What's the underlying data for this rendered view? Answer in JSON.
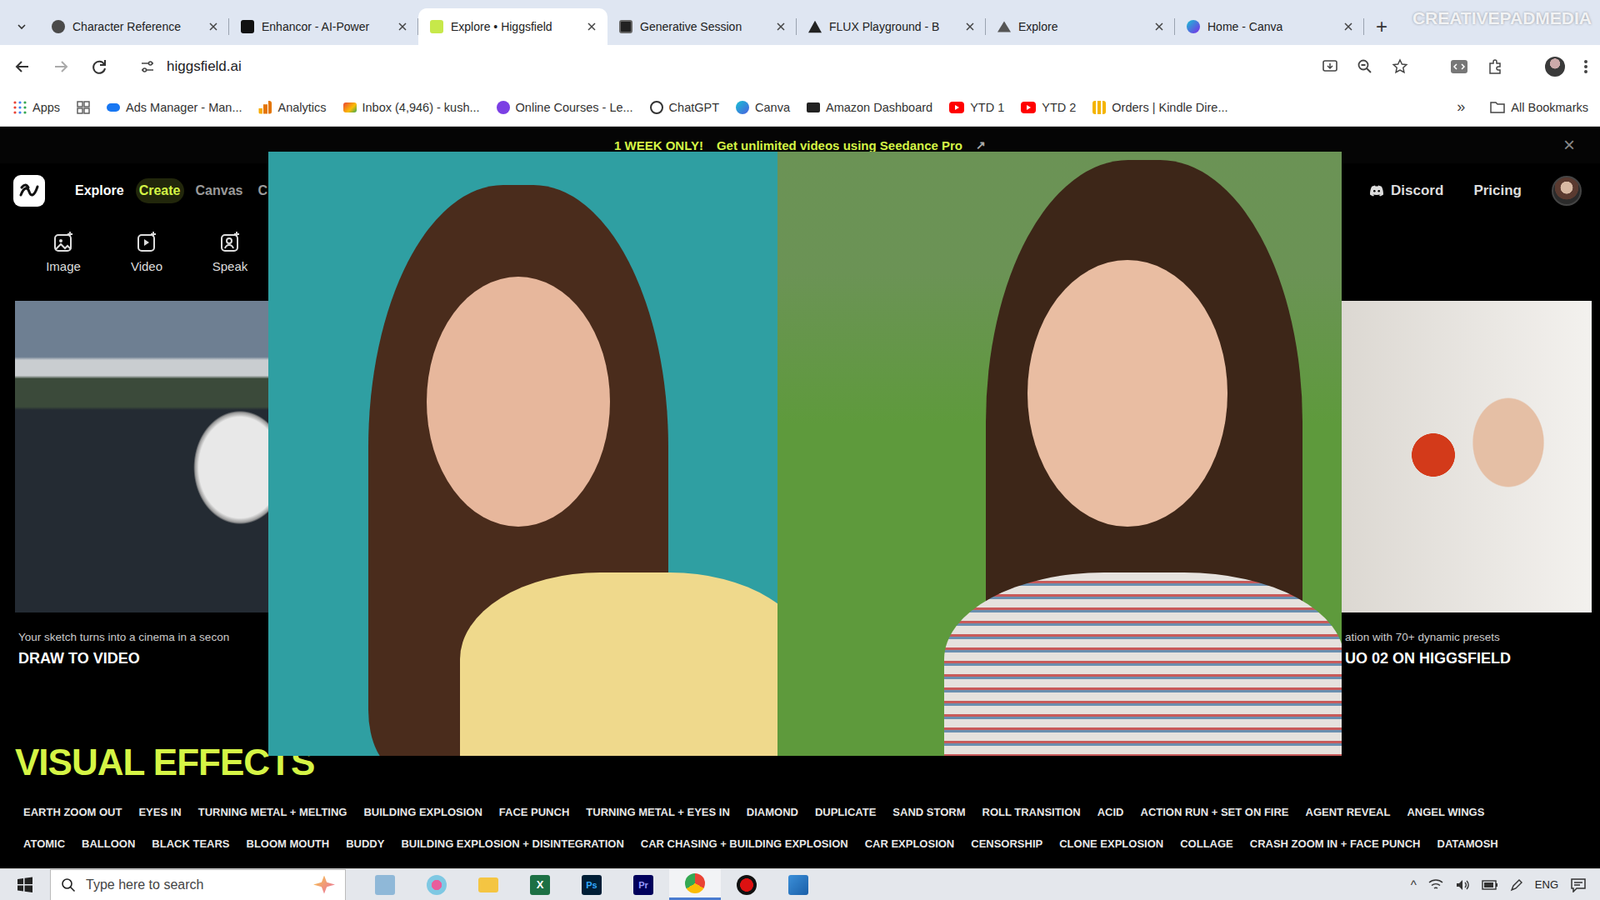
{
  "browser": {
    "tabs": [
      {
        "label": "Character Reference",
        "selected": false,
        "icon": "generic"
      },
      {
        "label": "Enhancor - AI-Power",
        "selected": false,
        "icon": "enhancor"
      },
      {
        "label": "Explore • Higgsfield",
        "selected": true,
        "icon": "higgsfield"
      },
      {
        "label": "Generative Session",
        "selected": false,
        "icon": "generative"
      },
      {
        "label": "FLUX Playground - B",
        "selected": false,
        "icon": "flux"
      },
      {
        "label": "Explore",
        "selected": false,
        "icon": "explore"
      },
      {
        "label": "Home - Canva",
        "selected": false,
        "icon": "canva"
      }
    ],
    "new_tab": "+",
    "watermark": "CREATIVEPADMEDIA",
    "url": "higgsfield.ai",
    "bookmarks": [
      {
        "label": "Apps",
        "icon": "apps"
      },
      {
        "label": "Ads Manager - Man...",
        "icon": "meta"
      },
      {
        "label": "Analytics",
        "icon": "analytics"
      },
      {
        "label": "Inbox (4,946) - kush...",
        "icon": "gmail"
      },
      {
        "label": "Online Courses - Le...",
        "icon": "courses"
      },
      {
        "label": "ChatGPT",
        "icon": "chatgpt"
      },
      {
        "label": "Canva",
        "icon": "canva"
      },
      {
        "label": "Amazon Dashboard",
        "icon": "amazon"
      },
      {
        "label": "YTD 1",
        "icon": "youtube"
      },
      {
        "label": "YTD 2",
        "icon": "youtube"
      },
      {
        "label": "Orders | Kindle Dire...",
        "icon": "kindle"
      }
    ],
    "bookmarks_more": "»",
    "all_bookmarks": "All Bookmarks"
  },
  "page": {
    "banner": {
      "highlight": "1 WEEK ONLY!",
      "text": "Get unlimited videos using Seedance Pro",
      "arrow": "↗",
      "close": "×"
    },
    "nav": {
      "items": [
        {
          "label": "Explore",
          "selected": true,
          "hovered": false
        },
        {
          "label": "Create",
          "selected": false,
          "hovered": true
        },
        {
          "label": "Canvas",
          "selected": false,
          "hovered": false
        },
        {
          "label": "C",
          "selected": false,
          "hovered": false
        }
      ],
      "right": [
        {
          "label": "Discord",
          "icon": "discord"
        },
        {
          "label": "Pricing",
          "icon": "none"
        }
      ]
    },
    "create_menu": [
      {
        "label": "Image",
        "icon": "image"
      },
      {
        "label": "Video",
        "icon": "video"
      },
      {
        "label": "Speak",
        "icon": "speak"
      }
    ],
    "cards": [
      {
        "caption": "Your sketch turns into a cinema in a secon",
        "title": "DRAW TO VIDEO"
      },
      {
        "caption": "ation with 70+ dynamic presets",
        "title": "UO 02 ON HIGGSFIELD"
      }
    ],
    "section_title": "VISUAL EFFECTS",
    "effects_rows": [
      [
        "EARTH ZOOM OUT",
        "EYES IN",
        "TURNING METAL + MELTING",
        "BUILDING EXPLOSION",
        "FACE PUNCH",
        "TURNING METAL + EYES IN",
        "DIAMOND",
        "DUPLICATE",
        "SAND STORM",
        "ROLL TRANSITION",
        "ACID",
        "ACTION RUN + SET ON FIRE",
        "AGENT REVEAL",
        "ANGEL WINGS"
      ],
      [
        "ATOMIC",
        "BALLOON",
        "BLACK TEARS",
        "BLOOM MOUTH",
        "BUDDY",
        "BUILDING EXPLOSION + DISINTEGRATION",
        "CAR CHASING + BUILDING EXPLOSION",
        "CAR EXPLOSION",
        "CENSORSHIP",
        "CLONE EXPLOSION",
        "COLLAGE",
        "CRASH ZOOM IN + FACE PUNCH",
        "DATAMOSH"
      ]
    ]
  },
  "overlay": {
    "panels": [
      {
        "name": "real-photo",
        "color": "#2f9fa2"
      },
      {
        "name": "ai-photo",
        "color": "#5e9a3c"
      }
    ]
  },
  "taskbar": {
    "search_placeholder": "Type here to search",
    "apps": [
      {
        "kind": "notes",
        "label": ""
      },
      {
        "kind": "paint",
        "label": ""
      },
      {
        "kind": "folder",
        "label": ""
      },
      {
        "kind": "excel",
        "label": "X"
      },
      {
        "kind": "photoshop",
        "label": "Ps"
      },
      {
        "kind": "premiere",
        "label": "Pr"
      },
      {
        "kind": "chrome",
        "label": ""
      },
      {
        "kind": "record",
        "label": ""
      },
      {
        "kind": "app",
        "label": ""
      }
    ],
    "tray_chevron": "^",
    "language": "ENG"
  }
}
